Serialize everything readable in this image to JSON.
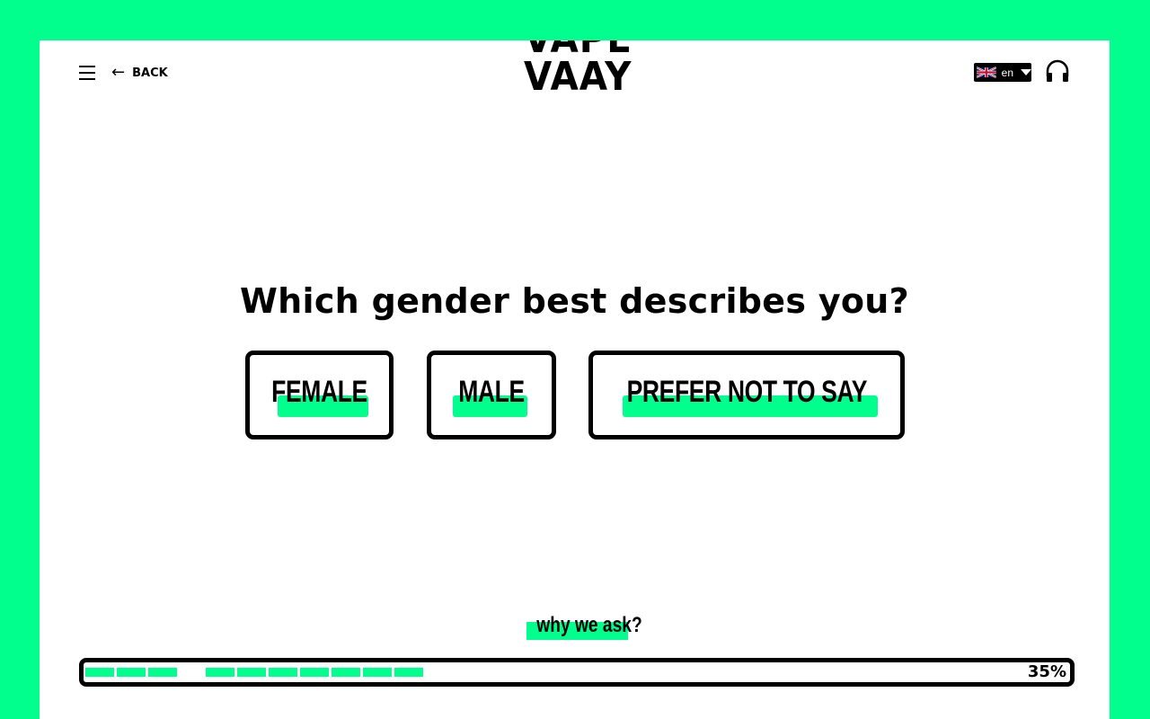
{
  "header": {
    "back_label": "BACK",
    "logo_line1": "VAPE",
    "logo_line2": "VAAY",
    "language": "en"
  },
  "question": "Which gender best describes you?",
  "options": [
    {
      "label": "FEMALE"
    },
    {
      "label": "MALE"
    },
    {
      "label": "PREFER NOT TO SAY"
    }
  ],
  "why_link": "why we ask?",
  "progress": {
    "label": "35%",
    "value": 0.35
  },
  "icons": {
    "menu": "hamburger-menu-icon",
    "back": "arrow-left-icon",
    "flag": "uk-flag-icon",
    "dropdown": "caret-down-icon",
    "support": "headphones-icon"
  },
  "colors": {
    "accent": "#00ff8c",
    "text": "#000000",
    "panel": "#ffffff"
  }
}
